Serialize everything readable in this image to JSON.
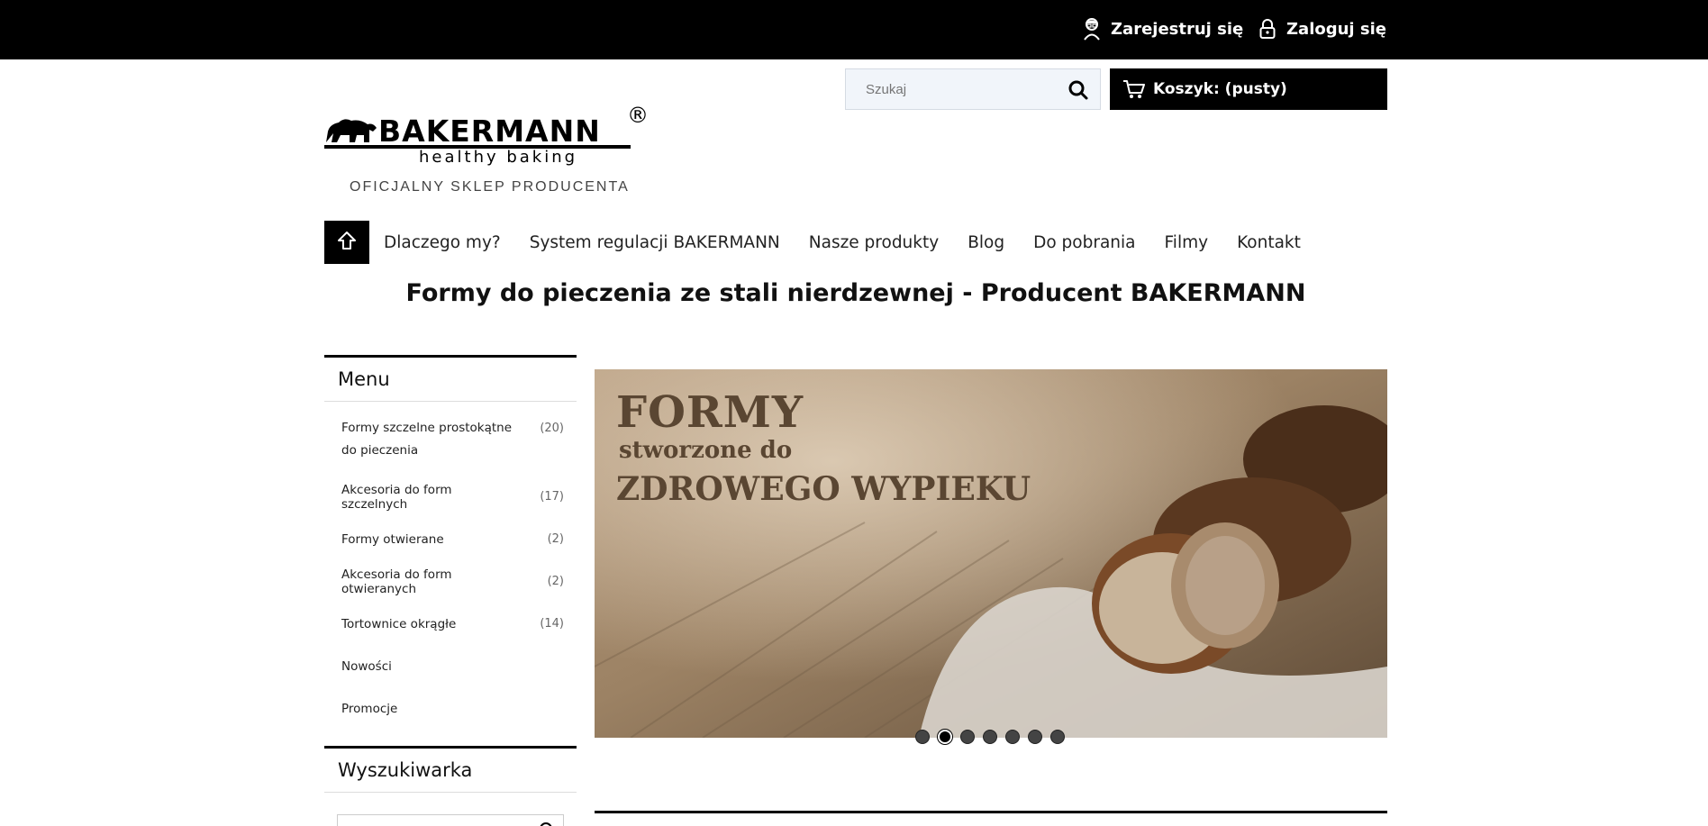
{
  "topbar": {
    "register_label": "Zarejestruj się",
    "login_label": "Zaloguj się"
  },
  "search": {
    "placeholder": "Szukaj"
  },
  "cart": {
    "label": "Koszyk: (pusty)"
  },
  "logo": {
    "brand": "BAKERMANN",
    "tagline": "healthy baking",
    "registered": "®",
    "official": "OFICJALNY SKLEP PRODUCENTA"
  },
  "nav": {
    "items": [
      {
        "label": "Dlaczego my?"
      },
      {
        "label": "System regulacji BAKERMANN"
      },
      {
        "label": "Nasze produkty"
      },
      {
        "label": "Blog"
      },
      {
        "label": "Do pobrania"
      },
      {
        "label": "Filmy"
      },
      {
        "label": "Kontakt"
      }
    ]
  },
  "page_title": "Formy do pieczenia ze stali nierdzewnej - Producent BAKERMANN",
  "sidebar": {
    "menu_title": "Menu",
    "items": [
      {
        "label": "Formy szczelne prostokątne do pieczenia",
        "count": "(20)"
      },
      {
        "label": "Akcesoria do form szczelnych",
        "count": "(17)"
      },
      {
        "label": "Formy otwierane",
        "count": "(2)"
      },
      {
        "label": "Akcesoria do form otwieranych",
        "count": "(2)"
      },
      {
        "label": "Tortownice okrągłe",
        "count": "(14)"
      },
      {
        "label": "Nowości",
        "count": ""
      },
      {
        "label": "Promocje",
        "count": ""
      }
    ],
    "search_title": "Wyszukiwarka"
  },
  "banner": {
    "line1": "FORMY",
    "line2": "stworzone do",
    "line3": "ZDROWEGO WYPIEKU"
  },
  "slider": {
    "dot_count": 7,
    "active_index": 1
  },
  "colors": {
    "topbar": "#000000",
    "accent": "#000000",
    "search_bg": "#f1f5fa",
    "banner_text": "#5a4632"
  }
}
